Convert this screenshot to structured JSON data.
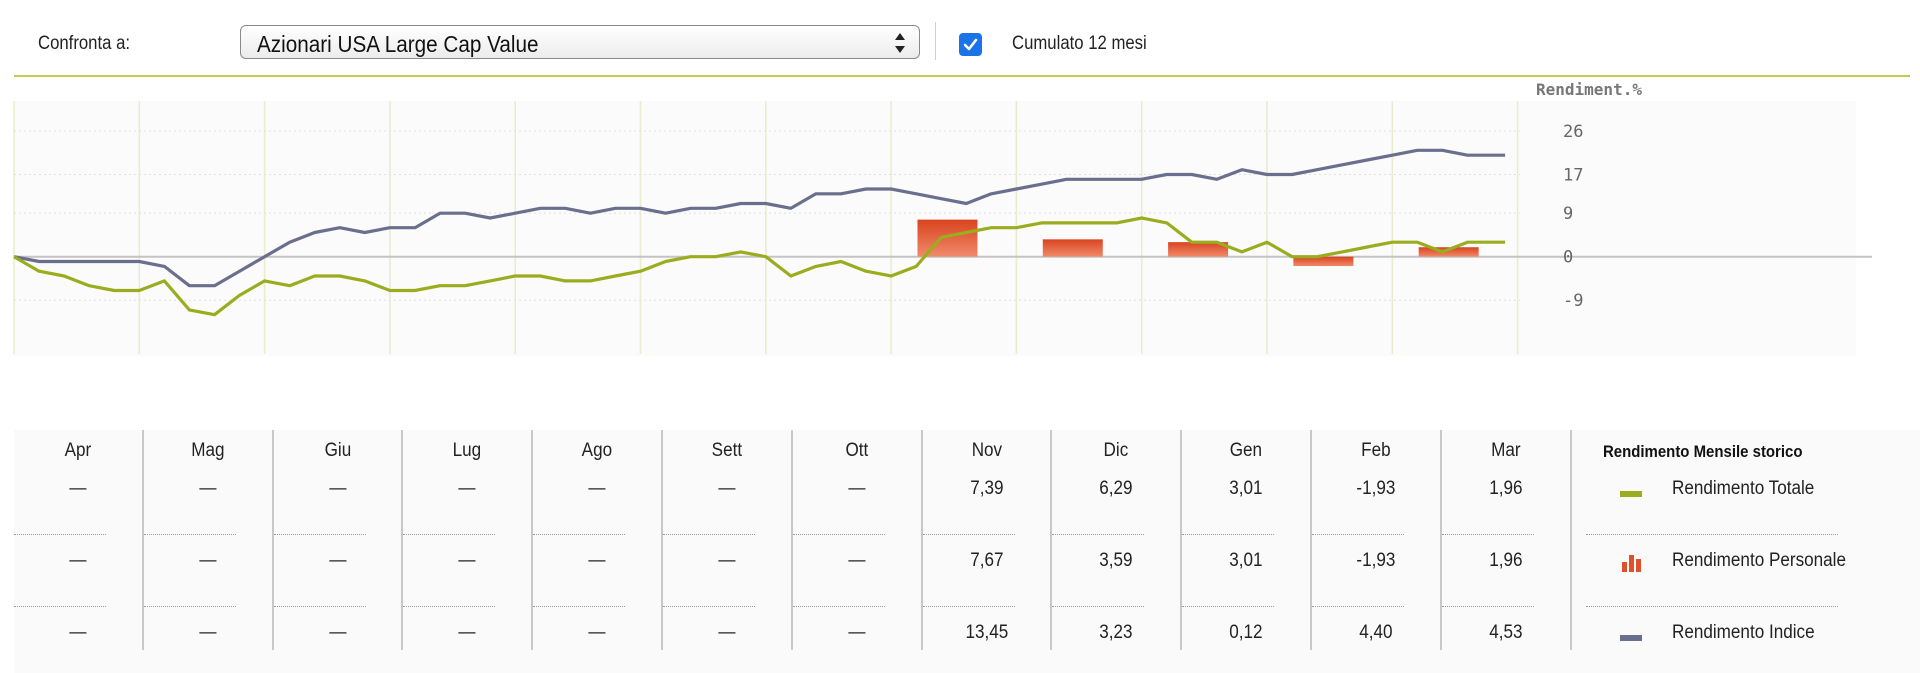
{
  "toolbar": {
    "compare_label": "Confronta a:",
    "select_value": "Azionari USA Large Cap Value",
    "cumulato_checked": true,
    "cumulato_label": "Cumulato 12 mesi"
  },
  "colors": {
    "total": "#9aad1f",
    "index": "#6b6f8e",
    "personal": "#e0502a",
    "rule": "#c9c94a",
    "checkbox": "#1a73e8"
  },
  "chart_data": {
    "type": "line",
    "ylabel": "Rendiment.%",
    "yticks": [
      26,
      17,
      9,
      0,
      -9
    ],
    "ylim": [
      -16,
      26
    ],
    "grid": true,
    "months": [
      "Apr",
      "Mag",
      "Giu",
      "Lug",
      "Ago",
      "Sett",
      "Ott",
      "Nov",
      "Dic",
      "Gen",
      "Feb",
      "Mar"
    ],
    "series": [
      {
        "name": "Rendimento Indice",
        "type": "line",
        "color": "#6b6f8e",
        "x": [
          0,
          0.2,
          0.4,
          0.6,
          0.8,
          1.0,
          1.2,
          1.4,
          1.6,
          1.8,
          2.0,
          2.2,
          2.4,
          2.6,
          2.8,
          3.0,
          3.2,
          3.4,
          3.6,
          3.8,
          4.0,
          4.2,
          4.4,
          4.6,
          4.8,
          5.0,
          5.2,
          5.4,
          5.6,
          5.8,
          6.0,
          6.2,
          6.4,
          6.6,
          6.8,
          7.0,
          7.2,
          7.4,
          7.6,
          7.8,
          8.0,
          8.2,
          8.4,
          8.6,
          8.8,
          9.0,
          9.2,
          9.4,
          9.6,
          9.8,
          10.0,
          10.2,
          10.4,
          10.6,
          10.8,
          11.0,
          11.2,
          11.4,
          11.6,
          11.9
        ],
        "y": [
          0,
          -1,
          -1,
          -1,
          -1,
          -1,
          -2,
          -6,
          -6,
          -3,
          0,
          3,
          5,
          6,
          5,
          6,
          6,
          9,
          9,
          8,
          9,
          10,
          10,
          9,
          10,
          10,
          9,
          10,
          10,
          11,
          11,
          10,
          13,
          13,
          14,
          14,
          13,
          12,
          11,
          13,
          14,
          15,
          16,
          16,
          16,
          16,
          17,
          17,
          16,
          18,
          17,
          17,
          18,
          19,
          20,
          21,
          22,
          22,
          21,
          21
        ]
      },
      {
        "name": "Rendimento Totale",
        "type": "line",
        "color": "#9aad1f",
        "x": [
          0,
          0.2,
          0.4,
          0.6,
          0.8,
          1.0,
          1.2,
          1.4,
          1.6,
          1.8,
          2.0,
          2.2,
          2.4,
          2.6,
          2.8,
          3.0,
          3.2,
          3.4,
          3.6,
          3.8,
          4.0,
          4.2,
          4.4,
          4.6,
          4.8,
          5.0,
          5.2,
          5.4,
          5.6,
          5.8,
          6.0,
          6.2,
          6.4,
          6.6,
          6.8,
          7.0,
          7.2,
          7.4,
          7.6,
          7.8,
          8.0,
          8.2,
          8.4,
          8.6,
          8.8,
          9.0,
          9.2,
          9.4,
          9.6,
          9.8,
          10.0,
          10.2,
          10.4,
          10.6,
          10.8,
          11.0,
          11.2,
          11.4,
          11.6,
          11.9
        ],
        "y": [
          0,
          -3,
          -4,
          -6,
          -7,
          -7,
          -5,
          -11,
          -12,
          -8,
          -5,
          -6,
          -4,
          -4,
          -5,
          -7,
          -7,
          -6,
          -6,
          -5,
          -4,
          -4,
          -5,
          -5,
          -4,
          -3,
          -1,
          0,
          0,
          1,
          0,
          -4,
          -2,
          -1,
          -3,
          -4,
          -2,
          4,
          5,
          6,
          6,
          7,
          7,
          7,
          7,
          8,
          7,
          3,
          3,
          1,
          3,
          0,
          0,
          1,
          2,
          3,
          3,
          1,
          3,
          3
        ]
      },
      {
        "name": "Rendimento Personale",
        "type": "bar",
        "color": "#e0502a",
        "categories": [
          "Nov",
          "Dic",
          "Gen",
          "Feb",
          "Mar"
        ],
        "values": [
          7.67,
          3.59,
          3.01,
          -1.93,
          1.96
        ]
      }
    ]
  },
  "table": {
    "columns": [
      {
        "month": "Apr",
        "totale": "—",
        "personale": "—",
        "indice": "—"
      },
      {
        "month": "Mag",
        "totale": "—",
        "personale": "—",
        "indice": "—"
      },
      {
        "month": "Giu",
        "totale": "—",
        "personale": "—",
        "indice": "—"
      },
      {
        "month": "Lug",
        "totale": "—",
        "personale": "—",
        "indice": "—"
      },
      {
        "month": "Ago",
        "totale": "—",
        "personale": "—",
        "indice": "—"
      },
      {
        "month": "Sett",
        "totale": "—",
        "personale": "—",
        "indice": "—"
      },
      {
        "month": "Ott",
        "totale": "—",
        "personale": "—",
        "indice": "—"
      },
      {
        "month": "Nov",
        "totale": "7,39",
        "personale": "7,67",
        "indice": "13,45"
      },
      {
        "month": "Dic",
        "totale": "6,29",
        "personale": "3,59",
        "indice": "3,23"
      },
      {
        "month": "Gen",
        "totale": "3,01",
        "personale": "3,01",
        "indice": "0,12"
      },
      {
        "month": "Feb",
        "totale": "-1,93",
        "personale": "-1,93",
        "indice": "4,40"
      },
      {
        "month": "Mar",
        "totale": "1,96",
        "personale": "1,96",
        "indice": "4,53"
      }
    ]
  },
  "legend": {
    "title": "Rendimento Mensile storico",
    "items": [
      {
        "label": "Rendimento Totale",
        "icon": "line-swatch-icon"
      },
      {
        "label": "Rendimento Personale",
        "icon": "bar-chart-icon"
      },
      {
        "label": "Rendimento Indice",
        "icon": "line-swatch-icon"
      }
    ]
  }
}
